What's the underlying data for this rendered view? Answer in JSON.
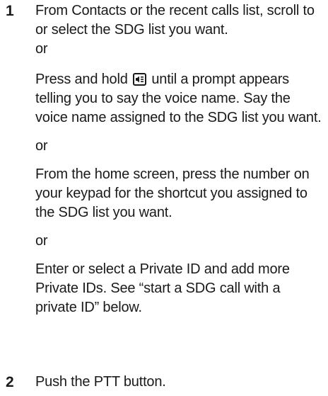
{
  "steps": [
    {
      "number": "1",
      "paragraphs": [
        "From Contacts or the recent calls list, scroll to or select the SDG list you want.",
        "or",
        {
          "before_icon": "Press and hold",
          "icon": "voice-key-icon",
          "after_icon": "until a prompt appears telling you to say the voice name. Say the voice name assigned to the SDG list you want."
        },
        "or",
        "From the home screen, press the number on your keypad for the shortcut you assigned to the SDG list you want.",
        "or",
        "Enter or select a Private ID and add more Private IDs. See “start a SDG call with a private ID” below."
      ]
    },
    {
      "number": "2",
      "paragraphs": [
        "Push the PTT button."
      ]
    }
  ]
}
